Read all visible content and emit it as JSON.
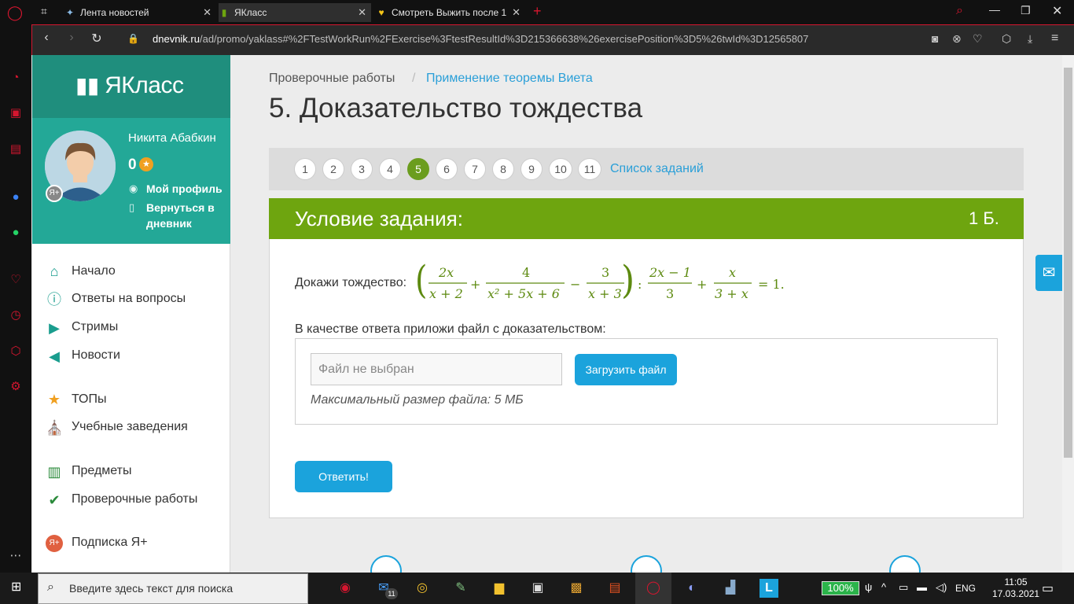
{
  "browser": {
    "tabs": [
      {
        "label": "Лента новостей"
      },
      {
        "label": "ЯКласс"
      },
      {
        "label": "Смотреть Выжить после 1"
      }
    ],
    "url_domain": "dnevnik.ru",
    "url_path": "/ad/promo/yaklass#%2FTestWorkRun%2FExercise%3FtestResultId%3D215366638%26exercisePosition%3D5%26twId%3D12565807"
  },
  "site": {
    "logo": "ЯКласс"
  },
  "profile": {
    "name": "Никита Абабкин",
    "points": "0",
    "links": [
      "Мой профиль",
      "Вернуться в",
      "дневник"
    ]
  },
  "nav": [
    {
      "label": "Начало",
      "icon": "home-icon"
    },
    {
      "label": "Ответы на вопросы",
      "icon": "question-icon"
    },
    {
      "label": "Стримы",
      "icon": "play-icon"
    },
    {
      "label": "Новости",
      "icon": "megaphone-icon"
    },
    {
      "label": "ТОПы",
      "icon": "star-icon"
    },
    {
      "label": "Учебные заведения",
      "icon": "bank-icon"
    },
    {
      "label": "Предметы",
      "icon": "book-icon"
    },
    {
      "label": "Проверочные работы",
      "icon": "check-icon"
    },
    {
      "label": "Подписка Я+",
      "icon": "yaplus-icon"
    }
  ],
  "breadcrumb": {
    "first": "Проверочные работы",
    "second": "Применение теоремы Виета"
  },
  "title": "5. Доказательство тождества",
  "questions": {
    "numbers": [
      "1",
      "2",
      "3",
      "4",
      "5",
      "6",
      "7",
      "8",
      "9",
      "10",
      "11"
    ],
    "active": "5",
    "list_label": "Список заданий"
  },
  "condition": {
    "header": "Условие задания:",
    "points": "1 Б."
  },
  "task": {
    "prompt": "Докажи тождество:",
    "answer_text": "В качестве ответа приложи файл с доказательством:",
    "file_placeholder": "Файл не выбран",
    "upload_label": "Загрузить файл",
    "max_size": "Максимальный размер файла: 5 МБ",
    "submit_label": "Ответить!"
  },
  "taskbar": {
    "search_placeholder": "Введите здесь текст для поиска",
    "battery": "100%",
    "lang": "ENG",
    "time": "11:05",
    "date": "17.03.2021",
    "mail_badge": "11"
  },
  "colors": {
    "accent": "#1ba3dc",
    "green": "#6ea50f",
    "teal": "#23a897",
    "opera": "#d6162f"
  }
}
